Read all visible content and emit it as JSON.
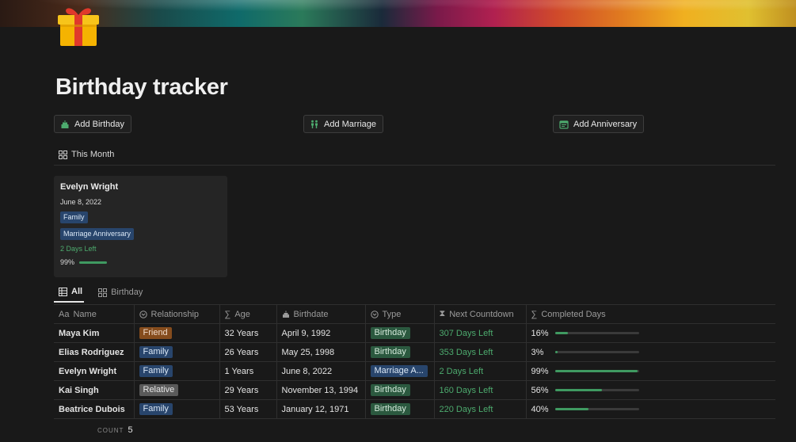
{
  "page": {
    "title": "Birthday tracker"
  },
  "buttons": {
    "add_birthday": "Add Birthday",
    "add_marriage": "Add Marriage",
    "add_anniversary": "Add Anniversary"
  },
  "this_month": {
    "view_label": "This Month",
    "card": {
      "name": "Evelyn Wright",
      "date": "June 8, 2022",
      "relationship": "Family",
      "type": "Marriage Anniversary",
      "countdown": "2 Days Left",
      "completed": "99%",
      "completed_value": 0.99
    }
  },
  "views": {
    "all": "All",
    "birthday": "Birthday"
  },
  "table": {
    "columns": {
      "name": "Name",
      "relationship": "Relationship",
      "age": "Age",
      "birthdate": "Birthdate",
      "type": "Type",
      "next_countdown": "Next Countdown",
      "completed_days": "Completed Days"
    },
    "name_prefix": "Aa",
    "rows": [
      {
        "name": "Maya Kim",
        "relationship": "Friend",
        "relationship_style": "friend",
        "age": "32 Years",
        "birthdate": "April 9, 1992",
        "type": "Birthday",
        "type_style": "birthday",
        "countdown": "307 Days Left",
        "completed": "16%",
        "completed_value": 0.16
      },
      {
        "name": "Elias Rodriguez",
        "relationship": "Family",
        "relationship_style": "family",
        "age": "26 Years",
        "birthdate": "May 25, 1998",
        "type": "Birthday",
        "type_style": "birthday",
        "countdown": "353 Days Left",
        "completed": "3%",
        "completed_value": 0.03
      },
      {
        "name": "Evelyn Wright",
        "relationship": "Family",
        "relationship_style": "family",
        "age": "1 Years",
        "birthdate": "June 8, 2022",
        "type": "Marriage A...",
        "type_style": "marriage",
        "countdown": "2 Days Left",
        "completed": "99%",
        "completed_value": 0.99
      },
      {
        "name": "Kai Singh",
        "relationship": "Relative",
        "relationship_style": "relative",
        "age": "29 Years",
        "birthdate": "November 13, 1994",
        "type": "Birthday",
        "type_style": "birthday",
        "countdown": "160 Days Left",
        "completed": "56%",
        "completed_value": 0.56
      },
      {
        "name": "Beatrice Dubois",
        "relationship": "Family",
        "relationship_style": "family",
        "age": "53 Years",
        "birthdate": "January 12, 1971",
        "type": "Birthday",
        "type_style": "birthday",
        "countdown": "220 Days Left",
        "completed": "40%",
        "completed_value": 0.4
      }
    ],
    "count_label": "COUNT",
    "count_value": "5"
  },
  "icons": {
    "page": "gift-icon",
    "add_birthday": "cake-icon",
    "add_marriage": "couple-icon",
    "add_anniversary": "calendar-icon"
  },
  "colors": {
    "background": "#191919",
    "accent_green": "#4dab6e",
    "tag_family": "#28456c",
    "tag_friend": "#854c1d",
    "tag_relative": "#5a5a5a",
    "tag_birthday": "#2b593f"
  }
}
